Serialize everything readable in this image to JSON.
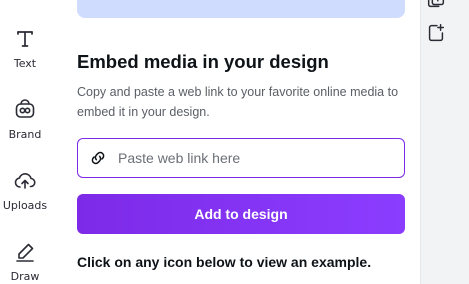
{
  "sidebar": {
    "items": [
      {
        "label": "Text",
        "icon": "text-icon"
      },
      {
        "label": "Brand",
        "icon": "brand-icon"
      },
      {
        "label": "Uploads",
        "icon": "upload-cloud-icon"
      },
      {
        "label": "Draw",
        "icon": "pen-icon"
      }
    ]
  },
  "embed": {
    "title": "Embed media in your design",
    "description": "Copy and paste a web link to your favorite online media to embed it in your design.",
    "input_placeholder": "Paste web link here",
    "input_value": "",
    "button_label": "Add to design",
    "hint": "Click on any icon below to view an example."
  },
  "colors": {
    "accent": "#8b3dff",
    "banner": "#cfdcfd",
    "text": "#0e1318"
  }
}
